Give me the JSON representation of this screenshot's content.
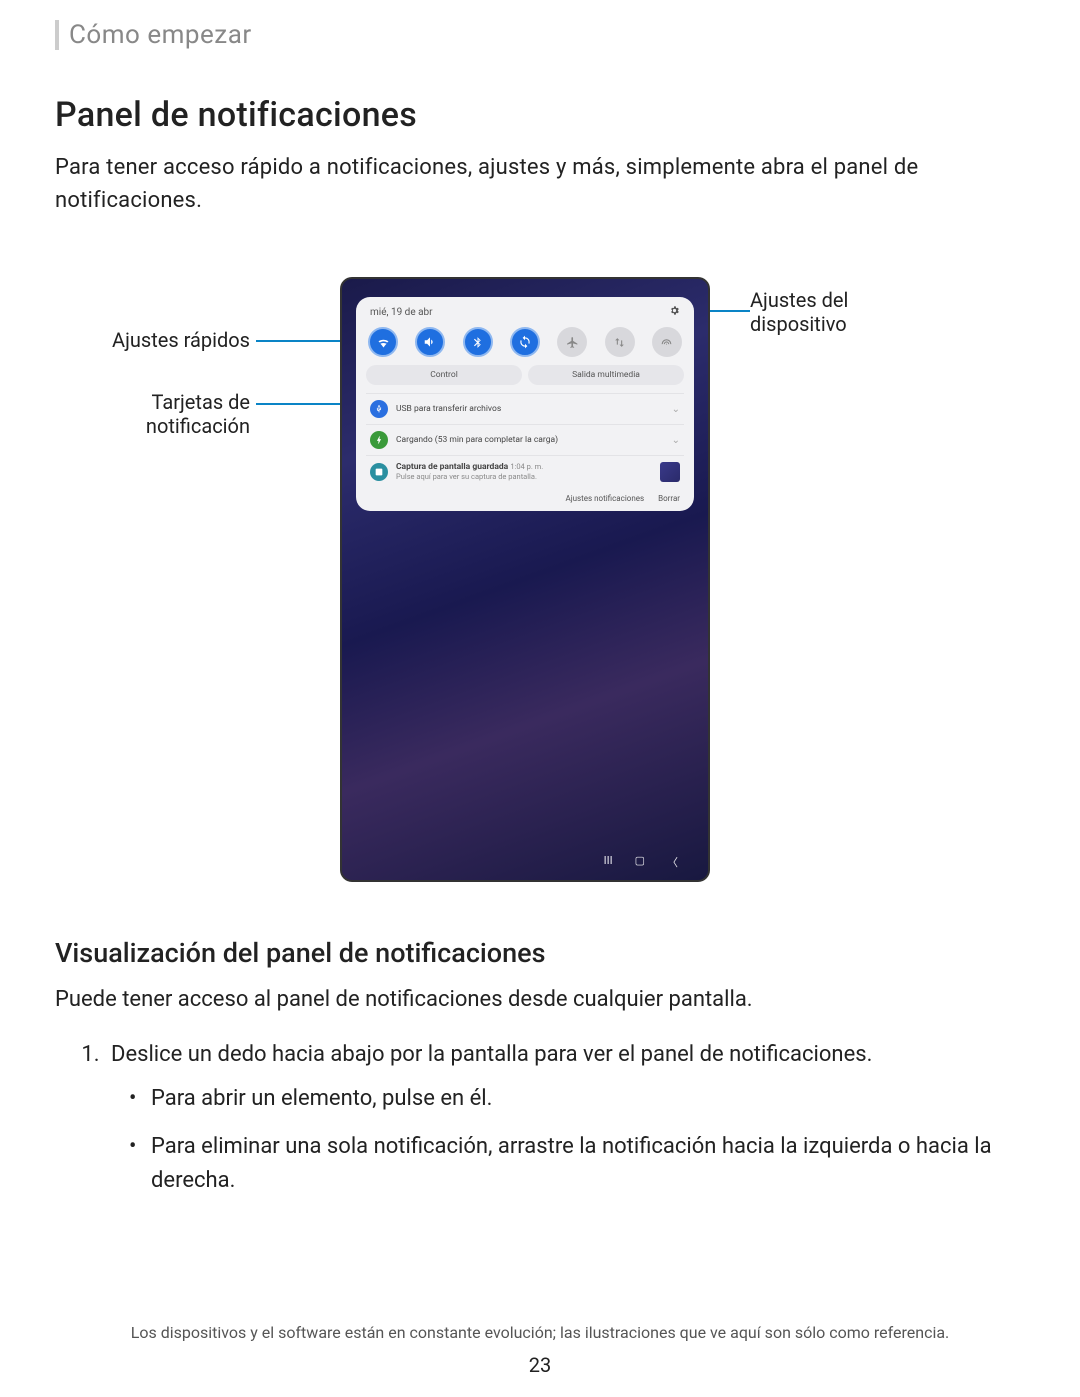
{
  "breadcrumb": "Cómo empezar",
  "title": "Panel de notificaciones",
  "intro": "Para tener acceso rápido a notificaciones, ajustes y más, simplemente abra el panel de notificaciones.",
  "callouts": {
    "quick_settings": "Ajustes rápidos",
    "notif_cards_l1": "Tarjetas de",
    "notif_cards_l2": "notificación",
    "device_settings_l1": "Ajustes del",
    "device_settings_l2": "dispositivo"
  },
  "device": {
    "date": "mié, 19 de abr",
    "control_label": "Control",
    "media_label": "Salida multimedia",
    "notifs": {
      "usb": "USB para transferir archivos",
      "charging": "Cargando (53 min para completar la carga)",
      "screenshot_title": "Captura de pantalla guardada",
      "screenshot_time": "1:04 p. m.",
      "screenshot_sub": "Pulse aquí para ver su captura de pantalla."
    },
    "footer": {
      "settings": "Ajustes notificaciones",
      "clear": "Borrar"
    }
  },
  "subhead": "Visualización del panel de notificaciones",
  "body": "Puede tener acceso al panel de notificaciones desde cualquier pantalla.",
  "step1": "Deslice un dedo hacia abajo por la pantalla para ver el panel de notificaciones.",
  "bullet1": "Para abrir un elemento, pulse en él.",
  "bullet2": "Para eliminar una sola notificación, arrastre la notificación hacia la izquierda o hacia la derecha.",
  "footnote": "Los dispositivos y el software están en constante evolución; las ilustraciones que ve aquí son sólo como referencia.",
  "pagenum": "23"
}
